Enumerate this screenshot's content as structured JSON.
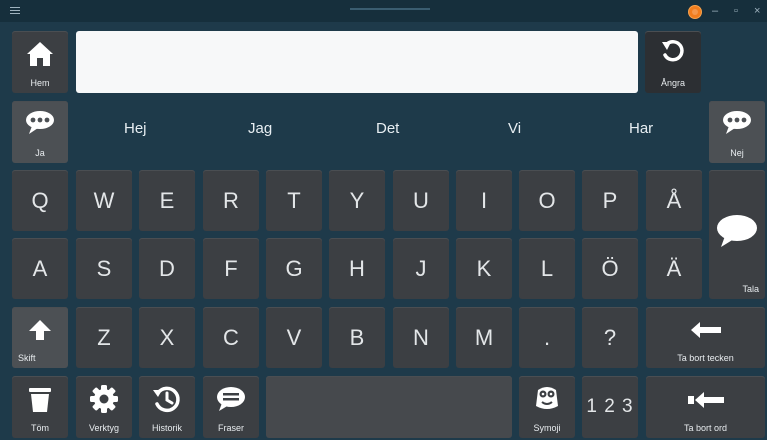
{
  "keys": {
    "home": "Hem",
    "undo": "Ångra",
    "yes": "Ja",
    "no": "Nej",
    "speak": "Tala",
    "shift": "Skift",
    "backspace_char": "Ta bort tecken",
    "clear": "Töm",
    "tools": "Verktyg",
    "history": "Historik",
    "phrases": "Fraser",
    "symoji": "Symoji",
    "numbers": "1 2 3",
    "backspace_word": "Ta bort ord"
  },
  "suggestions": [
    "Hej",
    "Jag",
    "Det",
    "Vi",
    "Har"
  ],
  "rows": {
    "row1": [
      "Q",
      "W",
      "E",
      "R",
      "T",
      "Y",
      "U",
      "I",
      "O",
      "P",
      "Å"
    ],
    "row2": [
      "A",
      "S",
      "D",
      "F",
      "G",
      "H",
      "J",
      "K",
      "L",
      "Ö",
      "Ä"
    ],
    "row3": [
      "Z",
      "X",
      "C",
      "V",
      "B",
      "N",
      "M",
      ".",
      "?"
    ]
  },
  "window": {
    "minimize": "–",
    "maximize": "▫",
    "close": "×"
  },
  "colors": {
    "background": "#1e3a4a",
    "key": "#3c3f43",
    "app_badge": "#f07d1e"
  }
}
